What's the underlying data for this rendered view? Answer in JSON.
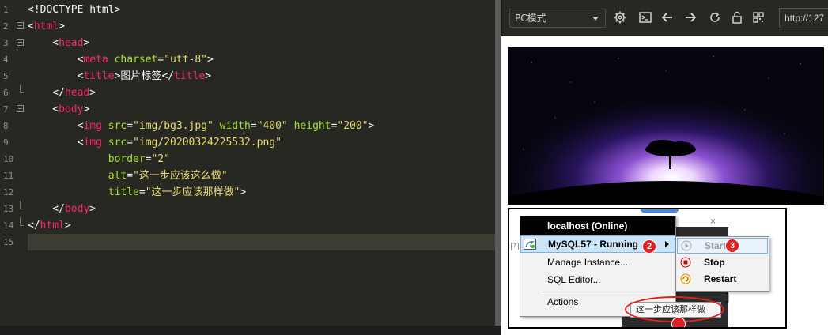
{
  "editor": {
    "line_numbers": [
      "1",
      "2",
      "3",
      "4",
      "5",
      "6",
      "7",
      "8",
      "9",
      "10",
      "11",
      "12",
      "13",
      "14",
      "15"
    ],
    "lines": [
      [
        {
          "c": "p",
          "t": "<!DOCTYPE html>"
        }
      ],
      [
        {
          "c": "p",
          "t": "<"
        },
        {
          "c": "t",
          "t": "html"
        },
        {
          "c": "p",
          "t": ">"
        }
      ],
      [
        {
          "c": "p",
          "t": "    <"
        },
        {
          "c": "t",
          "t": "head"
        },
        {
          "c": "p",
          "t": ">"
        }
      ],
      [
        {
          "c": "p",
          "t": "        <"
        },
        {
          "c": "t",
          "t": "meta"
        },
        {
          "c": "p",
          "t": " "
        },
        {
          "c": "a",
          "t": "charset"
        },
        {
          "c": "p",
          "t": "="
        },
        {
          "c": "s",
          "t": "\"utf-8\""
        },
        {
          "c": "p",
          "t": ">"
        }
      ],
      [
        {
          "c": "p",
          "t": "        <"
        },
        {
          "c": "t",
          "t": "title"
        },
        {
          "c": "p",
          "t": ">"
        },
        {
          "c": "x",
          "t": "图片标签"
        },
        {
          "c": "p",
          "t": "</"
        },
        {
          "c": "t",
          "t": "title"
        },
        {
          "c": "p",
          "t": ">"
        }
      ],
      [
        {
          "c": "p",
          "t": "    </"
        },
        {
          "c": "t",
          "t": "head"
        },
        {
          "c": "p",
          "t": ">"
        }
      ],
      [
        {
          "c": "p",
          "t": "    <"
        },
        {
          "c": "t",
          "t": "body"
        },
        {
          "c": "p",
          "t": ">"
        }
      ],
      [
        {
          "c": "p",
          "t": "        <"
        },
        {
          "c": "t",
          "t": "img"
        },
        {
          "c": "p",
          "t": " "
        },
        {
          "c": "a",
          "t": "src"
        },
        {
          "c": "p",
          "t": "="
        },
        {
          "c": "s",
          "t": "\"img/bg3.jpg\""
        },
        {
          "c": "p",
          "t": " "
        },
        {
          "c": "a",
          "t": "width"
        },
        {
          "c": "p",
          "t": "="
        },
        {
          "c": "s",
          "t": "\"400\""
        },
        {
          "c": "p",
          "t": " "
        },
        {
          "c": "a",
          "t": "height"
        },
        {
          "c": "p",
          "t": "="
        },
        {
          "c": "s",
          "t": "\"200\""
        },
        {
          "c": "p",
          "t": ">"
        }
      ],
      [
        {
          "c": "p",
          "t": "        <"
        },
        {
          "c": "t",
          "t": "img"
        },
        {
          "c": "p",
          "t": " "
        },
        {
          "c": "a",
          "t": "src"
        },
        {
          "c": "p",
          "t": "="
        },
        {
          "c": "s",
          "t": "\"img/20200324225532.png\""
        }
      ],
      [
        {
          "c": "p",
          "t": "             "
        },
        {
          "c": "a",
          "t": "border"
        },
        {
          "c": "p",
          "t": "="
        },
        {
          "c": "s",
          "t": "\"2\""
        }
      ],
      [
        {
          "c": "p",
          "t": "             "
        },
        {
          "c": "a",
          "t": "alt"
        },
        {
          "c": "p",
          "t": "="
        },
        {
          "c": "s",
          "t": "\"这一步应该这么做\""
        }
      ],
      [
        {
          "c": "p",
          "t": "             "
        },
        {
          "c": "a",
          "t": "title"
        },
        {
          "c": "p",
          "t": "="
        },
        {
          "c": "s",
          "t": "\"这一步应该那样做\""
        },
        {
          "c": "p",
          "t": ">"
        }
      ],
      [
        {
          "c": "p",
          "t": "    </"
        },
        {
          "c": "t",
          "t": "body"
        },
        {
          "c": "p",
          "t": ">"
        }
      ],
      [
        {
          "c": "p",
          "t": "</"
        },
        {
          "c": "t",
          "t": "html"
        },
        {
          "c": "p",
          "t": ">"
        }
      ],
      []
    ],
    "fold_open_lines": [
      2,
      3,
      7
    ],
    "fold_end_lines": [
      6,
      13,
      14
    ],
    "active_line": 15
  },
  "preview": {
    "mode_select": "PC模式",
    "url": "http://127",
    "toolbar_icons": [
      "settings-icon",
      "terminal-icon",
      "back-arrow-icon",
      "forward-arrow-icon",
      "refresh-icon",
      "lock-icon",
      "qr-code-icon"
    ],
    "screenshot_menu": {
      "header": "localhost (Online)",
      "items": [
        "MySQL57 - Running",
        "Manage Instance...",
        "SQL Editor...",
        "Actions"
      ],
      "submenu": [
        "Start",
        "Stop",
        "Restart"
      ],
      "tooltip": "这一步应该那样做",
      "markers": [
        "2",
        "3"
      ]
    }
  },
  "colors": {
    "editor_bg": "#272822",
    "tag": "#f92672",
    "attr": "#a6e22e",
    "string": "#e6db74",
    "text": "#f8f8f2",
    "marker_red": "#e02020"
  }
}
